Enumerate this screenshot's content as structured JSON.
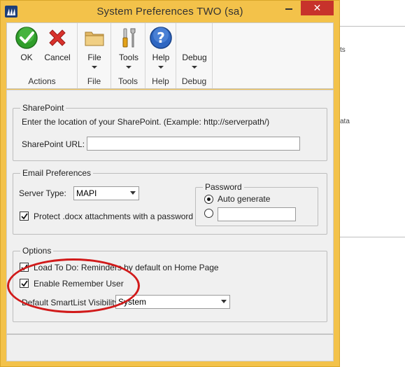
{
  "window": {
    "title": "System Preferences   TWO (sa)",
    "close_glyph": "✕"
  },
  "ribbon": {
    "groups": [
      {
        "label": "Actions",
        "buttons": [
          {
            "label": "OK",
            "icon": "ok-check-icon"
          },
          {
            "label": "Cancel",
            "icon": "cancel-x-icon"
          }
        ]
      },
      {
        "label": "File",
        "buttons": [
          {
            "label": "File",
            "icon": "folder-icon"
          }
        ]
      },
      {
        "label": "Tools",
        "buttons": [
          {
            "label": "Tools",
            "icon": "tools-icon"
          }
        ]
      },
      {
        "label": "Help",
        "buttons": [
          {
            "label": "Help",
            "icon": "help-icon"
          }
        ]
      },
      {
        "label": "Debug",
        "buttons": [
          {
            "label": "Debug",
            "icon": "debug-icon"
          }
        ]
      }
    ]
  },
  "sharepoint": {
    "legend": "SharePoint",
    "instruction": "Enter the location of your SharePoint. (Example: http://serverpath/)",
    "url_label": "SharePoint URL:",
    "url_value": ""
  },
  "email": {
    "legend": "Email Preferences",
    "server_type_label": "Server Type:",
    "server_type_value": "MAPI",
    "protect_label": "Protect .docx attachments with a password",
    "protect_checked": true,
    "password": {
      "legend": "Password",
      "auto_generate_label": "Auto generate",
      "auto_generate_selected": true,
      "custom_value": ""
    }
  },
  "options": {
    "legend": "Options",
    "load_todo_label": "Load To Do: Reminders by default on Home Page",
    "load_todo_checked": true,
    "remember_user_label": "Enable Remember User",
    "remember_user_checked": true,
    "smartlist_label": "Default SmartList Visibility:",
    "smartlist_value": "System"
  },
  "background": {
    "fragment_1": "ts",
    "fragment_2": "ata"
  },
  "colors": {
    "title_bar": "#f3c24a",
    "close_button": "#c7322b",
    "annotation": "#d11a1a"
  }
}
